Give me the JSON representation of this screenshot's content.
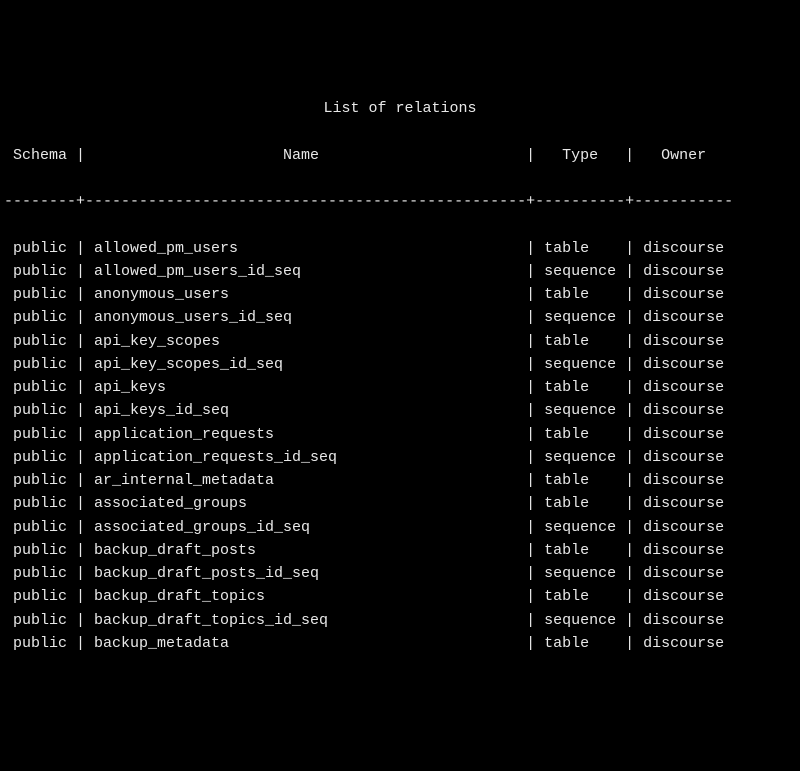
{
  "title": "List of relations",
  "columns": {
    "schema": "Schema",
    "name": "Name",
    "type": "Type",
    "owner": "Owner"
  },
  "separator": "--------+-------------------------------------------------+----------+-----------",
  "rows": [
    {
      "schema": "public",
      "name": "allowed_pm_users",
      "type": "table",
      "owner": "discourse"
    },
    {
      "schema": "public",
      "name": "allowed_pm_users_id_seq",
      "type": "sequence",
      "owner": "discourse"
    },
    {
      "schema": "public",
      "name": "anonymous_users",
      "type": "table",
      "owner": "discourse"
    },
    {
      "schema": "public",
      "name": "anonymous_users_id_seq",
      "type": "sequence",
      "owner": "discourse"
    },
    {
      "schema": "public",
      "name": "api_key_scopes",
      "type": "table",
      "owner": "discourse"
    },
    {
      "schema": "public",
      "name": "api_key_scopes_id_seq",
      "type": "sequence",
      "owner": "discourse"
    },
    {
      "schema": "public",
      "name": "api_keys",
      "type": "table",
      "owner": "discourse"
    },
    {
      "schema": "public",
      "name": "api_keys_id_seq",
      "type": "sequence",
      "owner": "discourse"
    },
    {
      "schema": "public",
      "name": "application_requests",
      "type": "table",
      "owner": "discourse"
    },
    {
      "schema": "public",
      "name": "application_requests_id_seq",
      "type": "sequence",
      "owner": "discourse"
    },
    {
      "schema": "public",
      "name": "ar_internal_metadata",
      "type": "table",
      "owner": "discourse"
    },
    {
      "schema": "public",
      "name": "associated_groups",
      "type": "table",
      "owner": "discourse"
    },
    {
      "schema": "public",
      "name": "associated_groups_id_seq",
      "type": "sequence",
      "owner": "discourse"
    },
    {
      "schema": "public",
      "name": "backup_draft_posts",
      "type": "table",
      "owner": "discourse"
    },
    {
      "schema": "public",
      "name": "backup_draft_posts_id_seq",
      "type": "sequence",
      "owner": "discourse"
    },
    {
      "schema": "public",
      "name": "backup_draft_topics",
      "type": "table",
      "owner": "discourse"
    },
    {
      "schema": "public",
      "name": "backup_draft_topics_id_seq",
      "type": "sequence",
      "owner": "discourse"
    },
    {
      "schema": "public",
      "name": "backup_metadata",
      "type": "table",
      "owner": "discourse"
    }
  ],
  "widths": {
    "schema": 8,
    "name": 49,
    "type": 10,
    "owner": 11
  }
}
